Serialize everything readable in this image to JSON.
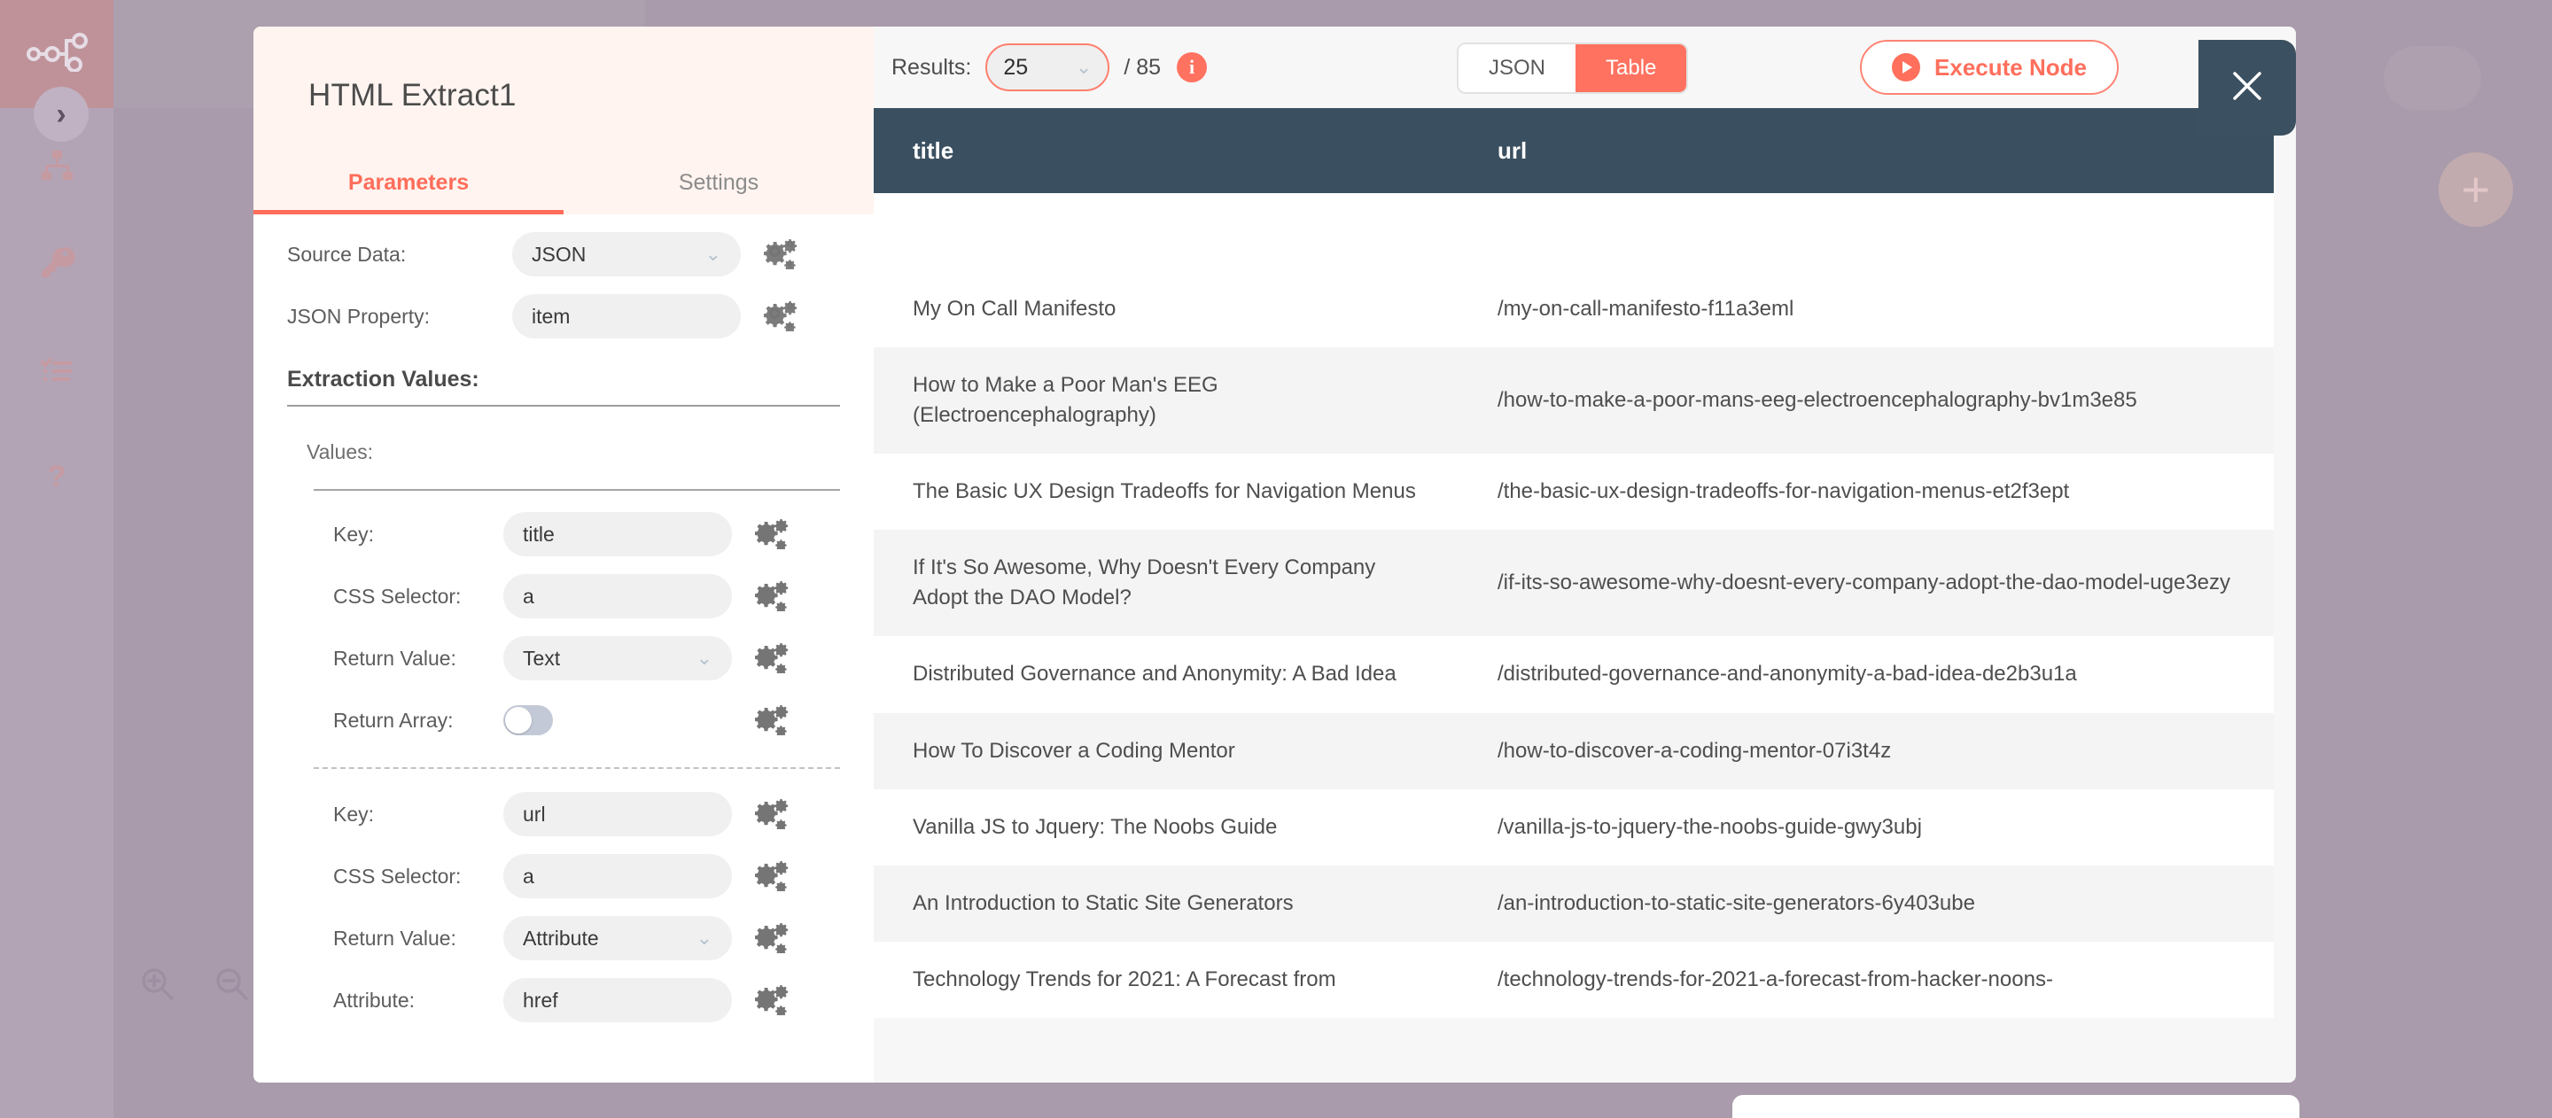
{
  "sidebar": {
    "logo_icon": "workflow-nodes-icon",
    "expand_icon": "chevron-right-icon",
    "items": [
      {
        "icon": "sitemap-icon",
        "name": "workflows"
      },
      {
        "icon": "key-icon",
        "name": "credentials"
      },
      {
        "icon": "checklist-icon",
        "name": "executions"
      },
      {
        "icon": "question-mark-icon",
        "name": "help"
      }
    ]
  },
  "canvas": {
    "zoom_in_icon": "magnifier-plus-icon",
    "zoom_out_icon": "magnifier-minus-icon",
    "add_node_label": "+"
  },
  "ndv": {
    "node_title": "HTML Extract1",
    "close_icon": "close-icon",
    "tabs": [
      {
        "label": "Parameters",
        "active": true
      },
      {
        "label": "Settings",
        "active": false
      }
    ],
    "parameters": {
      "source_data": {
        "label": "Source Data:",
        "value": "JSON",
        "type": "select",
        "gear_icon": "settings-gears-icon"
      },
      "json_property": {
        "label": "JSON Property:",
        "value": "item",
        "type": "text",
        "gear_icon": "settings-gears-icon"
      },
      "extraction_values_title": "Extraction Values:",
      "values_label": "Values:",
      "value_groups": [
        {
          "key": {
            "label": "Key:",
            "value": "title"
          },
          "css_selector": {
            "label": "CSS Selector:",
            "value": "a"
          },
          "return_value": {
            "label": "Return Value:",
            "value": "Text"
          },
          "return_array": {
            "label": "Return Array:",
            "value": "off"
          }
        },
        {
          "key": {
            "label": "Key:",
            "value": "url"
          },
          "css_selector": {
            "label": "CSS Selector:",
            "value": "a"
          },
          "return_value": {
            "label": "Return Value:",
            "value": "Attribute"
          },
          "attribute": {
            "label": "Attribute:",
            "value": "href"
          }
        }
      ]
    },
    "output": {
      "results_label": "Results:",
      "results_value": "25",
      "results_total": "/ 85",
      "info_icon": "info-icon",
      "view_toggle": [
        {
          "label": "JSON",
          "active": false
        },
        {
          "label": "Table",
          "active": true
        }
      ],
      "execute_button": {
        "label": "Execute Node",
        "icon": "play-icon"
      },
      "table": {
        "columns": [
          "title",
          "url"
        ],
        "rows": [
          {
            "title": "My On Call Manifesto",
            "url": "/my-on-call-manifesto-f11a3eml"
          },
          {
            "title": "How to Make a Poor Man's EEG (Electroencephalography)",
            "url": "/how-to-make-a-poor-mans-eeg-electroencephalography-bv1m3e85"
          },
          {
            "title": "The Basic UX Design Tradeoffs for Navigation Menus",
            "url": "/the-basic-ux-design-tradeoffs-for-navigation-menus-et2f3ept"
          },
          {
            "title": "If It's So Awesome, Why Doesn't Every Company Adopt the DAO Model?",
            "url": "/if-its-so-awesome-why-doesnt-every-company-adopt-the-dao-model-uge3ezy"
          },
          {
            "title": "Distributed Governance and Anonymity: A Bad Idea",
            "url": "/distributed-governance-and-anonymity-a-bad-idea-de2b3u1a"
          },
          {
            "title": "How To Discover a Coding Mentor",
            "url": "/how-to-discover-a-coding-mentor-07i3t4z"
          },
          {
            "title": "Vanilla JS to Jquery: The Noobs Guide",
            "url": "/vanilla-js-to-jquery-the-noobs-guide-gwy3ubj"
          },
          {
            "title": "An Introduction to Static Site Generators",
            "url": "/an-introduction-to-static-site-generators-6y403ube"
          },
          {
            "title": "Technology Trends for 2021: A Forecast from",
            "url": "/technology-trends-for-2021-a-forecast-from-hacker-noons-"
          }
        ]
      }
    }
  },
  "colors": {
    "accent": "#ff6d5a",
    "table_header": "#3a4f5f",
    "canvas": "#a99bab"
  }
}
